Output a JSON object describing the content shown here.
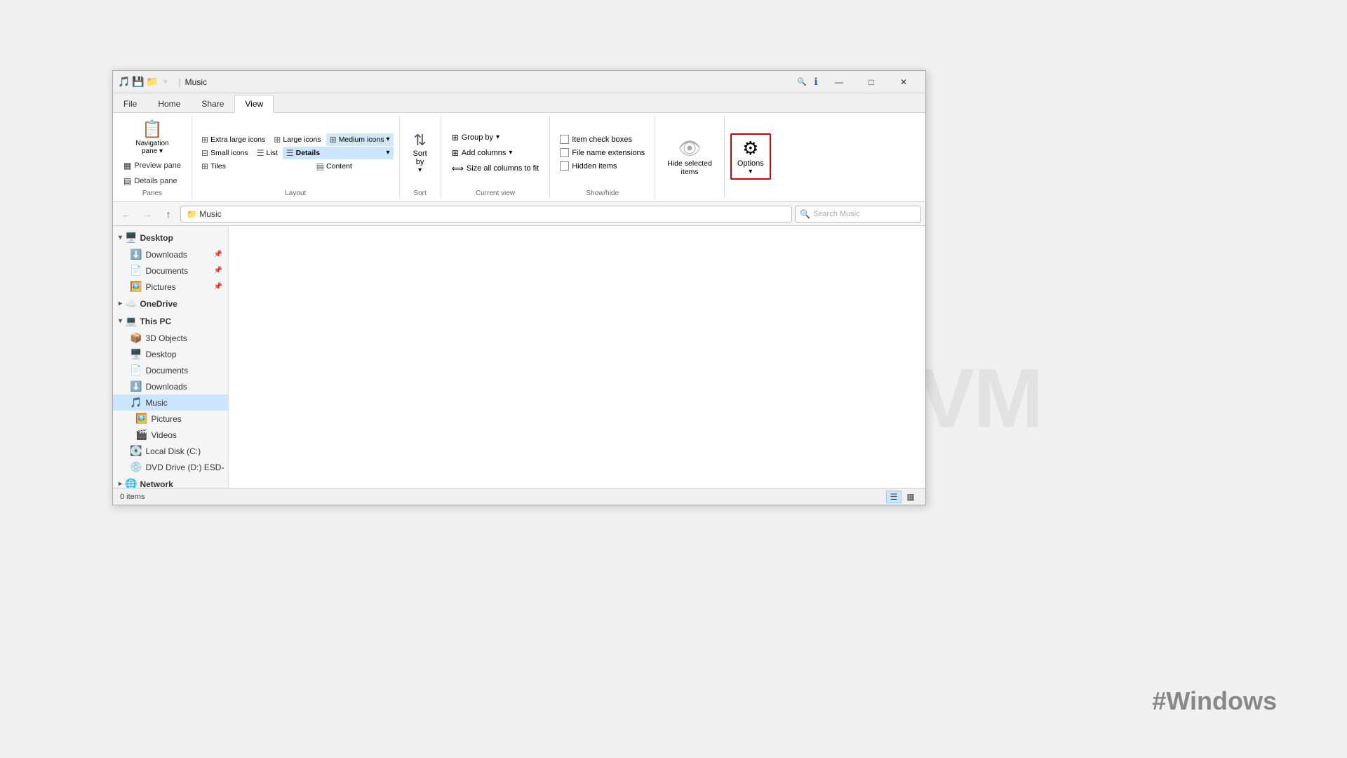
{
  "window": {
    "title": "Music",
    "breadcrumb": "Music"
  },
  "titlebar": {
    "icons": [
      "🎵",
      "💾",
      "📁"
    ],
    "separator": "|",
    "controls": {
      "minimize": "—",
      "maximize": "□",
      "close": "✕"
    }
  },
  "ribbon": {
    "tabs": [
      "File",
      "Home",
      "Share",
      "View"
    ],
    "active_tab": "View",
    "panes_group": {
      "label": "Panes",
      "navigation_pane": "Navigation\npane",
      "preview_pane": "Preview pane",
      "details_pane": "Details pane"
    },
    "layout_group": {
      "label": "Layout",
      "items": [
        "Extra large icons",
        "Large icons",
        "Medium icons",
        "Small icons",
        "List",
        "Details",
        "Tiles",
        "",
        "Content"
      ]
    },
    "sort_group": {
      "label": "Sort",
      "sort_by": "Sort\nby"
    },
    "current_view_group": {
      "label": "Current view",
      "group_by": "Group by",
      "add_columns": "Add columns",
      "size_all": "Size all columns to fit"
    },
    "show_hide_group": {
      "label": "Show/hide",
      "item_check_boxes": "Item check boxes",
      "file_name_extensions": "File name extensions",
      "hidden_items": "Hidden items"
    },
    "hide_selected_group": {
      "label": "",
      "hide_selected_items": "Hide selected\nitems"
    },
    "options_group": {
      "options": "Options"
    }
  },
  "address_bar": {
    "path": "Music",
    "search_placeholder": "Search Music"
  },
  "sidebar": {
    "items": [
      {
        "label": "Desktop",
        "icon": "🖥️",
        "type": "header",
        "indent": 0
      },
      {
        "label": "Downloads",
        "icon": "⬇️",
        "type": "item",
        "pinned": true,
        "indent": 1
      },
      {
        "label": "Documents",
        "icon": "📄",
        "type": "item",
        "pinned": true,
        "indent": 1
      },
      {
        "label": "Pictures",
        "icon": "🖼️",
        "type": "item",
        "pinned": true,
        "indent": 1
      },
      {
        "label": "OneDrive",
        "icon": "☁️",
        "type": "header",
        "indent": 0
      },
      {
        "label": "This PC",
        "icon": "💻",
        "type": "header",
        "indent": 0
      },
      {
        "label": "3D Objects",
        "icon": "📦",
        "type": "item",
        "indent": 1
      },
      {
        "label": "Desktop",
        "icon": "🖥️",
        "type": "item",
        "indent": 1
      },
      {
        "label": "Documents",
        "icon": "📄",
        "type": "item",
        "indent": 1
      },
      {
        "label": "Downloads",
        "icon": "⬇️",
        "type": "item",
        "indent": 1
      },
      {
        "label": "Music",
        "icon": "🎵",
        "type": "item",
        "selected": true,
        "indent": 1
      },
      {
        "label": "Pictures",
        "icon": "🖼️",
        "type": "item",
        "indent": 2
      },
      {
        "label": "Videos",
        "icon": "🎬",
        "type": "item",
        "indent": 2
      },
      {
        "label": "Local Disk (C:)",
        "icon": "💽",
        "type": "item",
        "indent": 1
      },
      {
        "label": "DVD Drive (D:) ESD-",
        "icon": "💿",
        "type": "item",
        "indent": 1
      },
      {
        "label": "Network",
        "icon": "🌐",
        "type": "header",
        "indent": 0
      }
    ]
  },
  "status_bar": {
    "items_count": "0 items",
    "view_buttons": [
      "▦",
      "☰"
    ]
  },
  "watermark": "NeuronVM",
  "hashtag": "#Windows"
}
